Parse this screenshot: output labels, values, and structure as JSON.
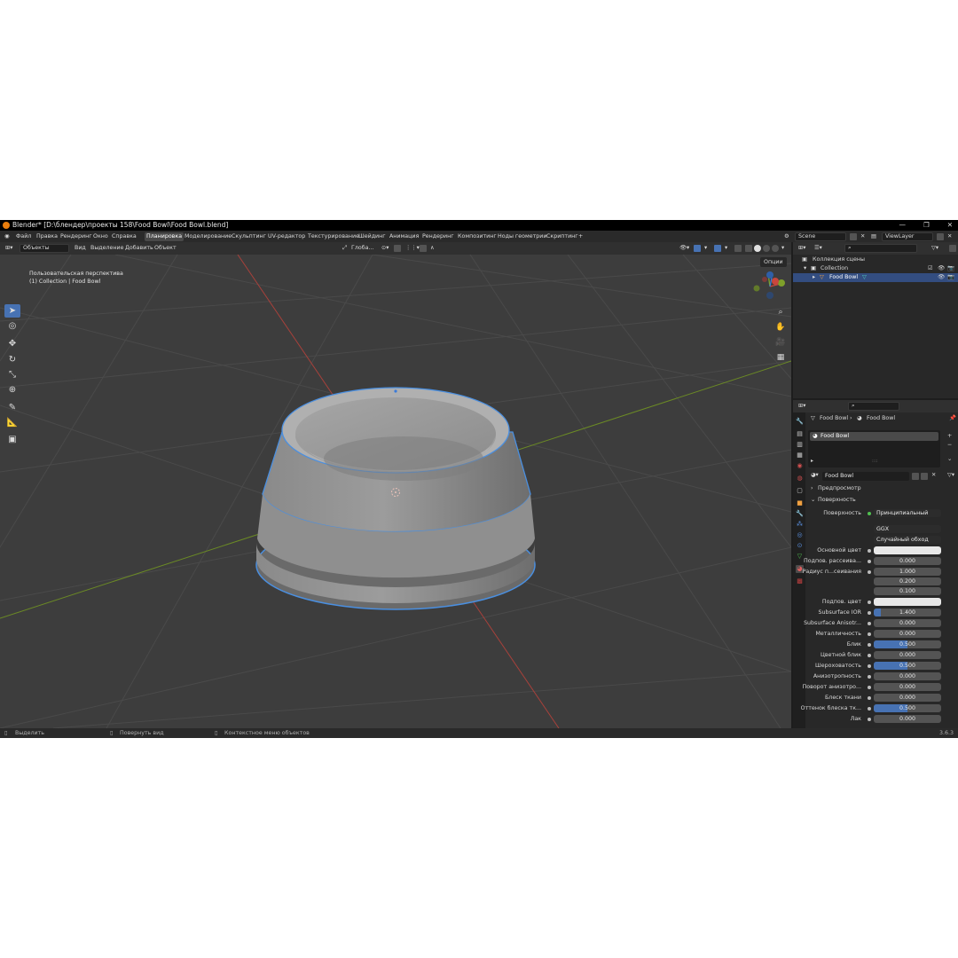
{
  "title": "Blender* [D:\\блендер\\проекты 158\\Food Bowl\\Food Bowl.blend]",
  "menu": [
    "Файл",
    "Правка",
    "Рендеринг",
    "Окно",
    "Справка"
  ],
  "workspaces": [
    "Планировка",
    "Моделирование",
    "Скульптинг",
    "UV-редактор",
    "Текстурирование",
    "Шейдинг",
    "Анимация",
    "Рендеринг",
    "Композитинг",
    "Ноды геометрии",
    "Скриптинг"
  ],
  "active_workspace": "Планировка",
  "scene": "Scene",
  "view_layer": "ViewLayer",
  "viewport": {
    "mode": "Объекты",
    "menus": [
      "Вид",
      "Выделение",
      "Добавить",
      "Объект"
    ],
    "transform_orientation": "Глоба...",
    "info_line1": "Пользовательская перспектива",
    "info_line2": "(1) Collection | Food Bowl",
    "options_label": "Опции"
  },
  "outliner": {
    "scene_collection": "Коллекция сцены",
    "collection": "Collection",
    "object": "Food Bowl"
  },
  "properties": {
    "breadcrumb_object": "Food Bowl",
    "breadcrumb_material": "Food Bowl",
    "slot": "Food Bowl",
    "material_name": "Food Bowl",
    "section_preview": "Предпросмотр",
    "section_surface": "Поверхность",
    "surface_label": "Поверхность",
    "surface_value": "Принципиальный BSDF",
    "distribution": "GGX",
    "subsurface_method": "Случайный обход",
    "fields": [
      {
        "label": "Основной цвет",
        "type": "color"
      },
      {
        "label": "Подпов. рассеива...",
        "value": "0.000"
      },
      {
        "label": "Радиус п...сеивания",
        "value": "1.000"
      },
      {
        "label": "",
        "value": "0.200"
      },
      {
        "label": "",
        "value": "0.100"
      },
      {
        "label": "Подпов. цвет",
        "type": "color"
      },
      {
        "label": "Subsurface IOR",
        "value": "1.400",
        "fill": 0.1
      },
      {
        "label": "Subsurface Anisotr...",
        "value": "0.000"
      },
      {
        "label": "Металличность",
        "value": "0.000"
      },
      {
        "label": "Блик",
        "value": "0.500",
        "fill": 0.5
      },
      {
        "label": "Цветной блик",
        "value": "0.000"
      },
      {
        "label": "Шероховатость",
        "value": "0.500",
        "fill": 0.5
      },
      {
        "label": "Анизотропность",
        "value": "0.000"
      },
      {
        "label": "Поворот анизотро...",
        "value": "0.000"
      },
      {
        "label": "Блеск ткани",
        "value": "0.000"
      },
      {
        "label": "Оттенок блеска тк...",
        "value": "0.500",
        "fill": 0.5
      },
      {
        "label": "Лак",
        "value": "0.000"
      }
    ]
  },
  "statusbar": {
    "select": "Выделить",
    "rotate": "Повернуть вид",
    "context": "Контекстное меню объектов",
    "version": "3.6.3"
  },
  "colors": {
    "accent": "#4772b3",
    "selection_outline": "#4a8fe0",
    "x_axis": "#c9463d",
    "y_axis": "#7ea02a"
  }
}
